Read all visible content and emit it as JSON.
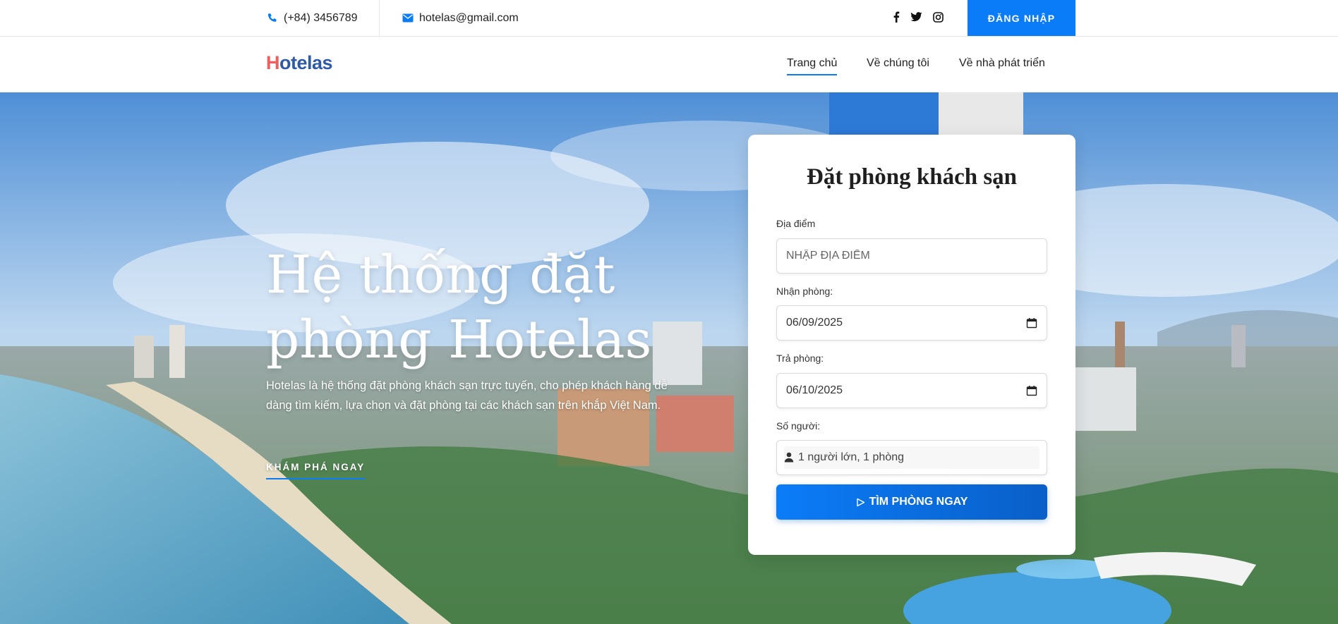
{
  "topbar": {
    "phone": "(+84) 3456789",
    "email": "hotelas@gmail.com",
    "social": [
      "facebook-icon",
      "twitter-icon",
      "instagram-icon"
    ],
    "login_label": "ĐĂNG NHẬP"
  },
  "nav": {
    "logo_first": "H",
    "logo_rest": "otelas",
    "links": [
      "Trang chủ",
      "Về chúng tôi",
      "Về nhà phát triển"
    ],
    "active": "Trang chủ"
  },
  "hero": {
    "title": "Hệ thống đặt phòng Hotelas",
    "description": "Hotelas là hệ thống đặt phòng khách sạn trực tuyến, cho phép khách hàng dễ dàng tìm kiếm, lựa chọn và đặt phòng tại các khách sạn trên khắp Việt Nam.",
    "cta": "KHÁM PHÁ NGAY"
  },
  "booking": {
    "title": "Đặt phòng khách sạn",
    "location_label": "Địa điểm",
    "location_placeholder": "NHẬP ĐỊA ĐIỂM",
    "checkin_label": "Nhận phòng:",
    "checkin_value": "06/09/2025",
    "checkout_label": "Trả phòng:",
    "checkout_value": "06/10/2025",
    "guests_label": "Số người:",
    "guests_value": "1 người lớn, 1 phòng",
    "search_label": "TÌM PHÒNG NGAY"
  },
  "colors": {
    "primary": "#0b7cf8",
    "logo_accent": "#f25c5c",
    "logo_main": "#2f5aa8"
  }
}
